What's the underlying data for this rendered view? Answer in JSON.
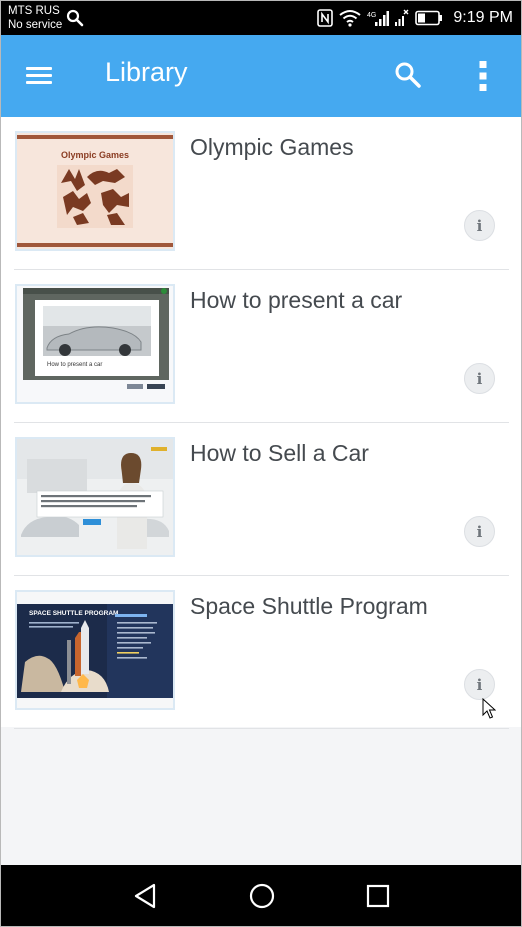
{
  "status_bar": {
    "carrier_line1": "MTS RUS",
    "carrier_line2": "No service",
    "network": "4G",
    "time": "9:19 PM"
  },
  "app_bar": {
    "title": "Library",
    "background_color": "#45a9f0"
  },
  "items": [
    {
      "title": "Olympic Games",
      "thumbnail": "olympic-games-thumbnail",
      "thumb_text": "Olympic Games"
    },
    {
      "title": "How to present a car",
      "thumbnail": "present-car-thumbnail",
      "thumb_text": "How to present a car"
    },
    {
      "title": "How to Sell a Car",
      "thumbnail": "sell-car-thumbnail",
      "thumb_text": ""
    },
    {
      "title": "Space Shuttle Program",
      "thumbnail": "space-shuttle-thumbnail",
      "thumb_text": "SPACE SHUTTLE PROGRAM"
    }
  ],
  "icons": {
    "menu": "hamburger-menu-icon",
    "search": "search-icon",
    "more": "more-vertical-icon",
    "info": "info-icon"
  }
}
